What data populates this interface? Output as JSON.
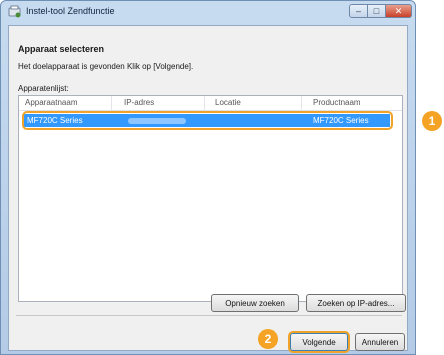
{
  "window": {
    "title": "Instel-tool Zendfunctie",
    "minimize_glyph": "–",
    "maximize_glyph": "□",
    "close_glyph": "✕"
  },
  "dialog": {
    "heading": "Apparaat selecteren",
    "instruction": "Het doelapparaat is gevonden Klik op [Volgende].",
    "list_label": "Apparatenlijst:"
  },
  "device_list": {
    "columns": [
      "Apparaatnaam",
      "IP-adres",
      "Locatie",
      "Productnaam"
    ],
    "rows": [
      {
        "device_name": "MF720C Series",
        "ip_address": "",
        "location": "",
        "product_name": "MF720C Series",
        "selected": true
      }
    ]
  },
  "buttons": {
    "research": "Opnieuw zoeken",
    "search_ip": "Zoeken op IP-adres...",
    "next": "Volgende",
    "cancel": "Annuleren"
  },
  "callouts": {
    "one": "1",
    "two": "2"
  },
  "colors": {
    "selection": "#3399ff",
    "callout": "#f4a324"
  }
}
